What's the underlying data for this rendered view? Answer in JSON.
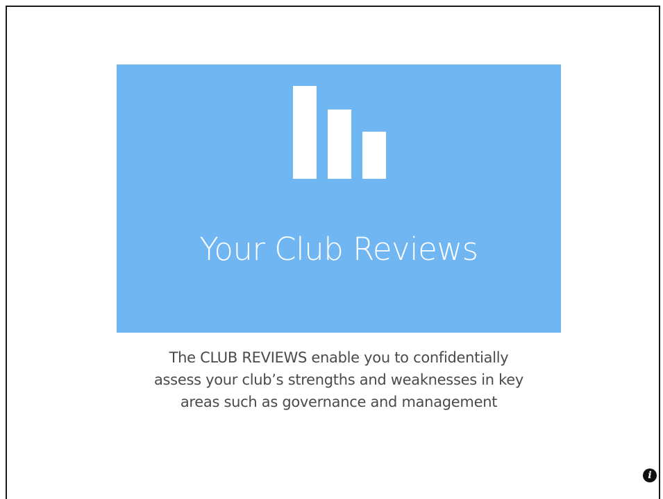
{
  "tile": {
    "title": "Your Club Reviews",
    "background": "#6fb6f2",
    "icon": "bar-chart-icon"
  },
  "description": {
    "lines": [
      "The CLUB REVIEWS enable you to confidentially",
      "assess your club’s strengths and weaknesses in key",
      "areas such as governance and management"
    ]
  },
  "info_button": {
    "icon": "info-icon",
    "glyph": "i"
  }
}
